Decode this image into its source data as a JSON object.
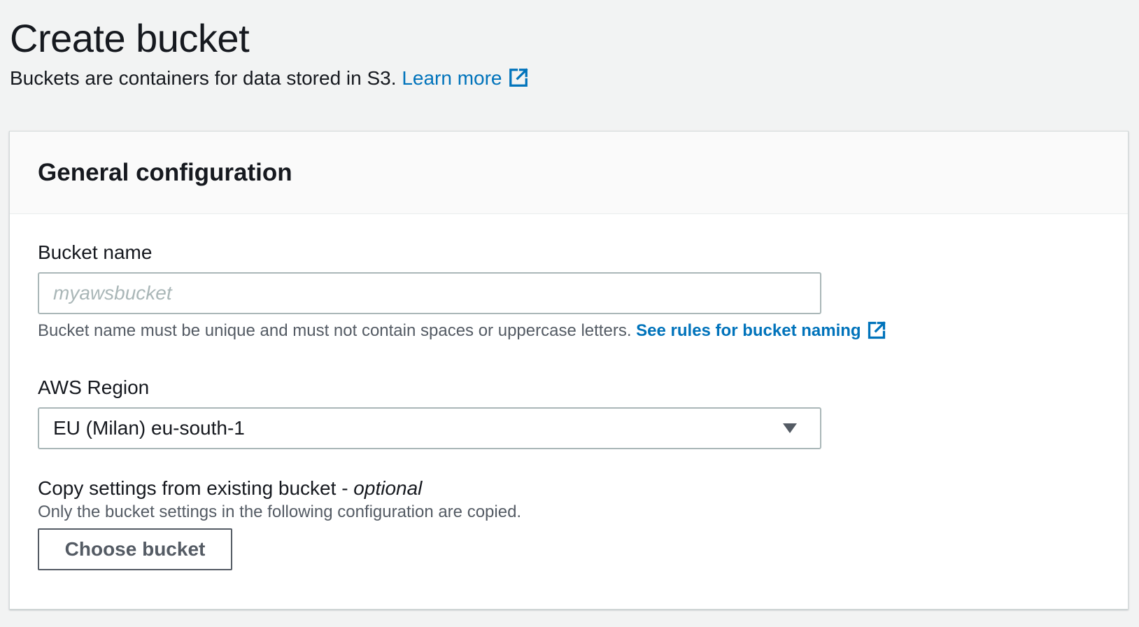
{
  "header": {
    "title": "Create bucket",
    "description": "Buckets are containers for data stored in S3.",
    "learn_more": "Learn more"
  },
  "panel": {
    "title": "General configuration",
    "bucket_name": {
      "label": "Bucket name",
      "value": "",
      "placeholder": "myawsbucket",
      "help": "Bucket name must be unique and must not contain spaces or uppercase letters.",
      "help_link": "See rules for bucket naming"
    },
    "region": {
      "label": "AWS Region",
      "selected": "EU (Milan) eu-south-1"
    },
    "copy_settings": {
      "label": "Copy settings from existing bucket - ",
      "label_suffix": "optional",
      "help": "Only the bucket settings in the following configuration are copied.",
      "button": "Choose bucket"
    }
  },
  "colors": {
    "link": "#0073bb",
    "text": "#16191f",
    "muted": "#545b64",
    "border": "#aab7b8",
    "background": "#f2f3f3"
  },
  "icons": {
    "external_link": "external-link-icon",
    "dropdown": "caret-down-icon"
  }
}
